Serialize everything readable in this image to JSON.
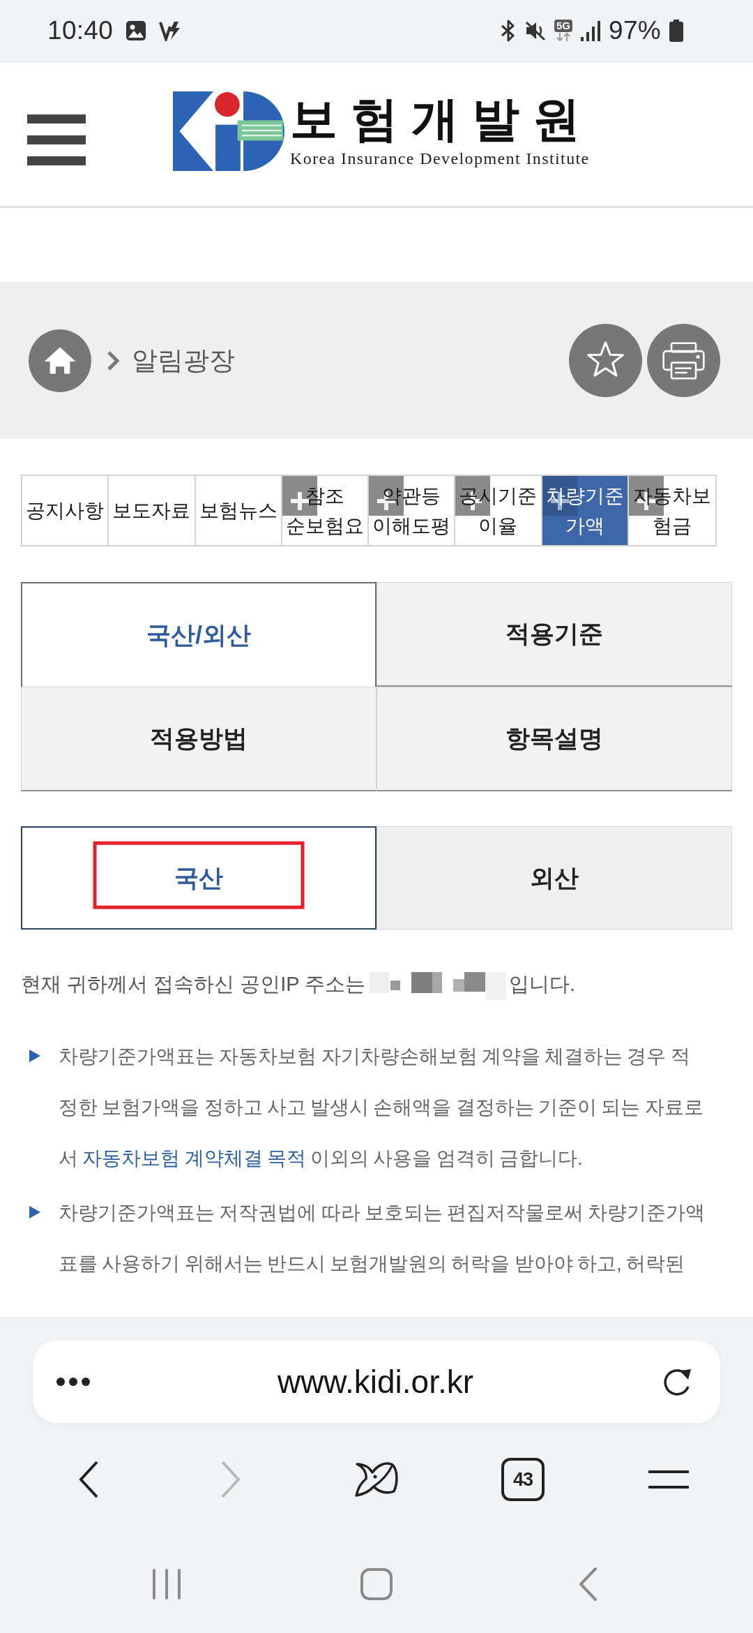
{
  "status_bar": {
    "time": "10:40",
    "network_type": "5G",
    "battery": "97%"
  },
  "header": {
    "logo_title": "보험개발원",
    "logo_subtitle": "Korea Insurance Development Institute"
  },
  "breadcrumb": {
    "current": "알림광장"
  },
  "category_tabs": [
    {
      "label": "공지사항",
      "selected": false,
      "expandable": false
    },
    {
      "label": "보도자료",
      "selected": false,
      "expandable": false
    },
    {
      "label": "보험뉴스",
      "selected": false,
      "expandable": false
    },
    {
      "label": "참조 순보험요",
      "selected": false,
      "expandable": true
    },
    {
      "label": "약관등 이해도평",
      "selected": false,
      "expandable": true
    },
    {
      "label": "공시기준이율",
      "selected": false,
      "expandable": true
    },
    {
      "label": "차량기준가액",
      "selected": true,
      "expandable": true
    },
    {
      "label": "자동차보험금",
      "selected": false,
      "expandable": true
    }
  ],
  "section_tabs": [
    {
      "label": "국산/외산",
      "selected": true
    },
    {
      "label": "적용기준",
      "selected": false
    },
    {
      "label": "적용방법",
      "selected": false
    },
    {
      "label": "항목설명",
      "selected": false
    }
  ],
  "origin_tabs": [
    {
      "label": "국산",
      "selected": true,
      "highlighted": true
    },
    {
      "label": "외산",
      "selected": false,
      "highlighted": false
    }
  ],
  "ip_notice": {
    "before": "현재 귀하께서 접속하신 공인IP 주소는",
    "after": "입니다."
  },
  "notices": [
    {
      "parts": [
        {
          "text": "차량기준가액표는 자동차보험 자기차량손해보험 계약을 체결하는 경우 적정한 보험가액을 정하고 사고 발생시 손해액을 결정하는 기준이 되는 자료로서 ",
          "link": false
        },
        {
          "text": "자동차보험 계약체결 목적",
          "link": true
        },
        {
          "text": " 이외의 사용을 엄격히 금합니다.",
          "link": false
        }
      ]
    },
    {
      "parts": [
        {
          "text": "차량기준가액표는 저작권법에 따라 보호되는 편집저작물로써 차량기준가액표를 사용하기 위해서는 반드시 보험개발원의 허락을 받아야 하고, 허락된",
          "link": false
        }
      ]
    }
  ],
  "browser": {
    "url": "www.kidi.or.kr",
    "tab_count": "43",
    "forward_disabled": true
  }
}
